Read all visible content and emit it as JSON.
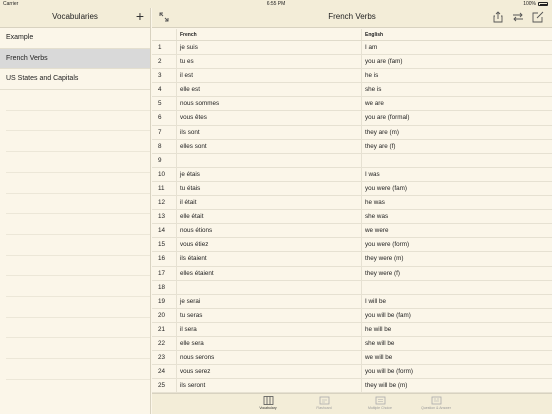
{
  "status_bar": {
    "carrier": "Carrier",
    "time": "6:55 PM",
    "battery": "100%"
  },
  "sidebar": {
    "title": "Vocabularies",
    "add_label": "+",
    "items": [
      {
        "label": "Example",
        "selected": false
      },
      {
        "label": "French Verbs",
        "selected": true
      },
      {
        "label": "US States and Capitals",
        "selected": false
      }
    ]
  },
  "main": {
    "title": "French Verbs",
    "columns": {
      "french": "French",
      "english": "English"
    },
    "rows": [
      {
        "num": "1",
        "french": "je suis",
        "english": "I am"
      },
      {
        "num": "2",
        "french": "tu es",
        "english": "you are (fam)"
      },
      {
        "num": "3",
        "french": "il est",
        "english": "he is"
      },
      {
        "num": "4",
        "french": "elle est",
        "english": "she is"
      },
      {
        "num": "5",
        "french": "nous sommes",
        "english": "we are"
      },
      {
        "num": "6",
        "french": "vous êtes",
        "english": "you are (formal)"
      },
      {
        "num": "7",
        "french": "ils sont",
        "english": "they are (m)"
      },
      {
        "num": "8",
        "french": "elles sont",
        "english": "they are (f)"
      },
      {
        "num": "9",
        "french": "",
        "english": ""
      },
      {
        "num": "10",
        "french": "je étais",
        "english": "I was"
      },
      {
        "num": "11",
        "french": "tu étais",
        "english": "you were (fam)"
      },
      {
        "num": "12",
        "french": "il était",
        "english": "he was"
      },
      {
        "num": "13",
        "french": "elle était",
        "english": "she was"
      },
      {
        "num": "14",
        "french": "nous étions",
        "english": "we were"
      },
      {
        "num": "15",
        "french": "vous étiez",
        "english": "you were (form)"
      },
      {
        "num": "16",
        "french": "ils étaient",
        "english": "they were (m)"
      },
      {
        "num": "17",
        "french": "elles étaient",
        "english": "they were (f)"
      },
      {
        "num": "18",
        "french": "",
        "english": ""
      },
      {
        "num": "19",
        "french": "je serai",
        "english": "I will be"
      },
      {
        "num": "20",
        "french": "tu seras",
        "english": "you will be (fam)"
      },
      {
        "num": "21",
        "french": "il sera",
        "english": "he will be"
      },
      {
        "num": "22",
        "french": "elle sera",
        "english": "she will be"
      },
      {
        "num": "23",
        "french": "nous serons",
        "english": "we will be"
      },
      {
        "num": "24",
        "french": "vous serez",
        "english": "you will be (form)"
      },
      {
        "num": "25",
        "french": "ils seront",
        "english": "they will be (m)"
      }
    ]
  },
  "tabs": [
    {
      "label": "Vocabulary",
      "icon": "book-icon",
      "active": true
    },
    {
      "label": "Flashcard",
      "icon": "flashcard-icon",
      "active": false
    },
    {
      "label": "Multiple Choice",
      "icon": "multiple-choice-icon",
      "active": false
    },
    {
      "label": "Question & Answer",
      "icon": "question-answer-icon",
      "active": false
    }
  ]
}
